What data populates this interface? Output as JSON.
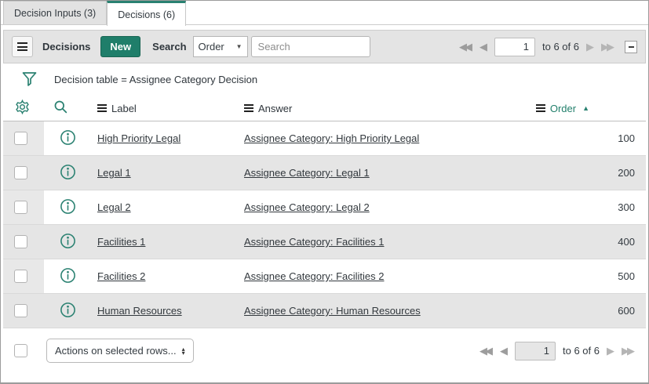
{
  "colors": {
    "accent": "#2a8171",
    "new_button": "#1f7e6a"
  },
  "tabs": [
    {
      "label": "Decision Inputs (3)"
    },
    {
      "label": "Decisions (6)"
    }
  ],
  "toolbar": {
    "title": "Decisions",
    "new_label": "New",
    "search_label": "Search",
    "field_selected": "Order",
    "search_placeholder": "Search"
  },
  "pagination_top": {
    "page": "1",
    "range": "to 6 of 6"
  },
  "pagination_bottom": {
    "page": "1",
    "range": "to 6 of 6"
  },
  "filter": {
    "text": "Decision table = Assignee Category Decision"
  },
  "table": {
    "columns": {
      "label": "Label",
      "answer": "Answer",
      "order": "Order"
    },
    "sort": {
      "column": "Order",
      "direction": "ascending"
    },
    "rows": [
      {
        "label": "High Priority Legal",
        "answer": "Assignee Category: High Priority Legal",
        "order": "100"
      },
      {
        "label": "Legal 1",
        "answer": "Assignee Category: Legal 1",
        "order": "200"
      },
      {
        "label": "Legal 2",
        "answer": "Assignee Category: Legal 2",
        "order": "300"
      },
      {
        "label": "Facilities 1",
        "answer": "Assignee Category: Facilities 1",
        "order": "400"
      },
      {
        "label": "Facilities 2",
        "answer": "Assignee Category: Facilities 2",
        "order": "500"
      },
      {
        "label": "Human Resources",
        "answer": "Assignee Category: Human Resources",
        "order": "600"
      }
    ]
  },
  "footer": {
    "actions_label": "Actions on selected rows..."
  }
}
